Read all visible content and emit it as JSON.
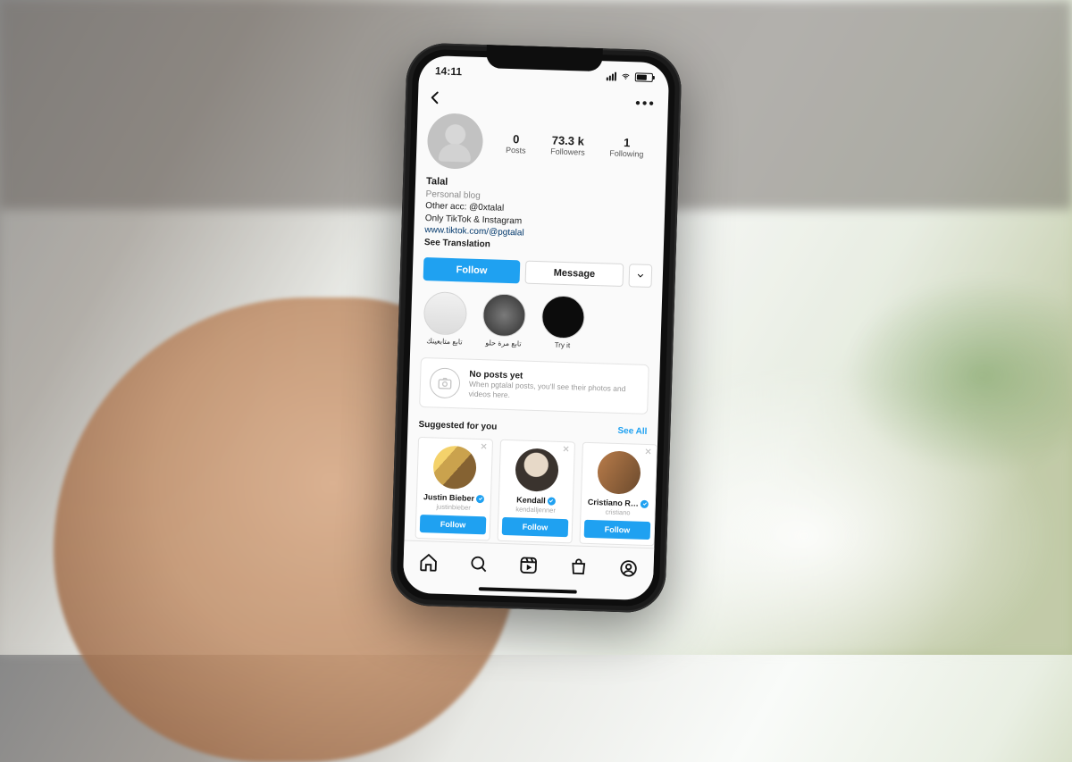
{
  "status": {
    "time": "14:11"
  },
  "profile": {
    "display_name": "Talal",
    "category": "Personal blog",
    "bio_line1": "Other acc: @0xtalal",
    "bio_line2": "Only TikTok & Instagram",
    "link": "www.tiktok.com/@pgtalal",
    "see_translation": "See Translation"
  },
  "stats": {
    "posts": {
      "value": "0",
      "label": "Posts"
    },
    "followers": {
      "value": "73.3 k",
      "label": "Followers"
    },
    "following": {
      "value": "1",
      "label": "Following"
    }
  },
  "actions": {
    "follow": "Follow",
    "message": "Message"
  },
  "highlights": [
    {
      "label": "تابع متابعينك"
    },
    {
      "label": "تابع مرة حلو"
    },
    {
      "label": "Try it"
    }
  ],
  "empty_state": {
    "title": "No posts yet",
    "subtitle": "When pgtalal posts, you'll see their photos and videos here."
  },
  "suggested": {
    "heading": "Suggested for you",
    "see_all": "See All",
    "cards": [
      {
        "name": "Justin Bieber",
        "handle": "justinbieber",
        "follow": "Follow"
      },
      {
        "name": "Kendall",
        "handle": "kendalljenner",
        "follow": "Follow"
      },
      {
        "name": "Cristiano R…",
        "handle": "cristiano",
        "follow": "Follow"
      }
    ]
  }
}
